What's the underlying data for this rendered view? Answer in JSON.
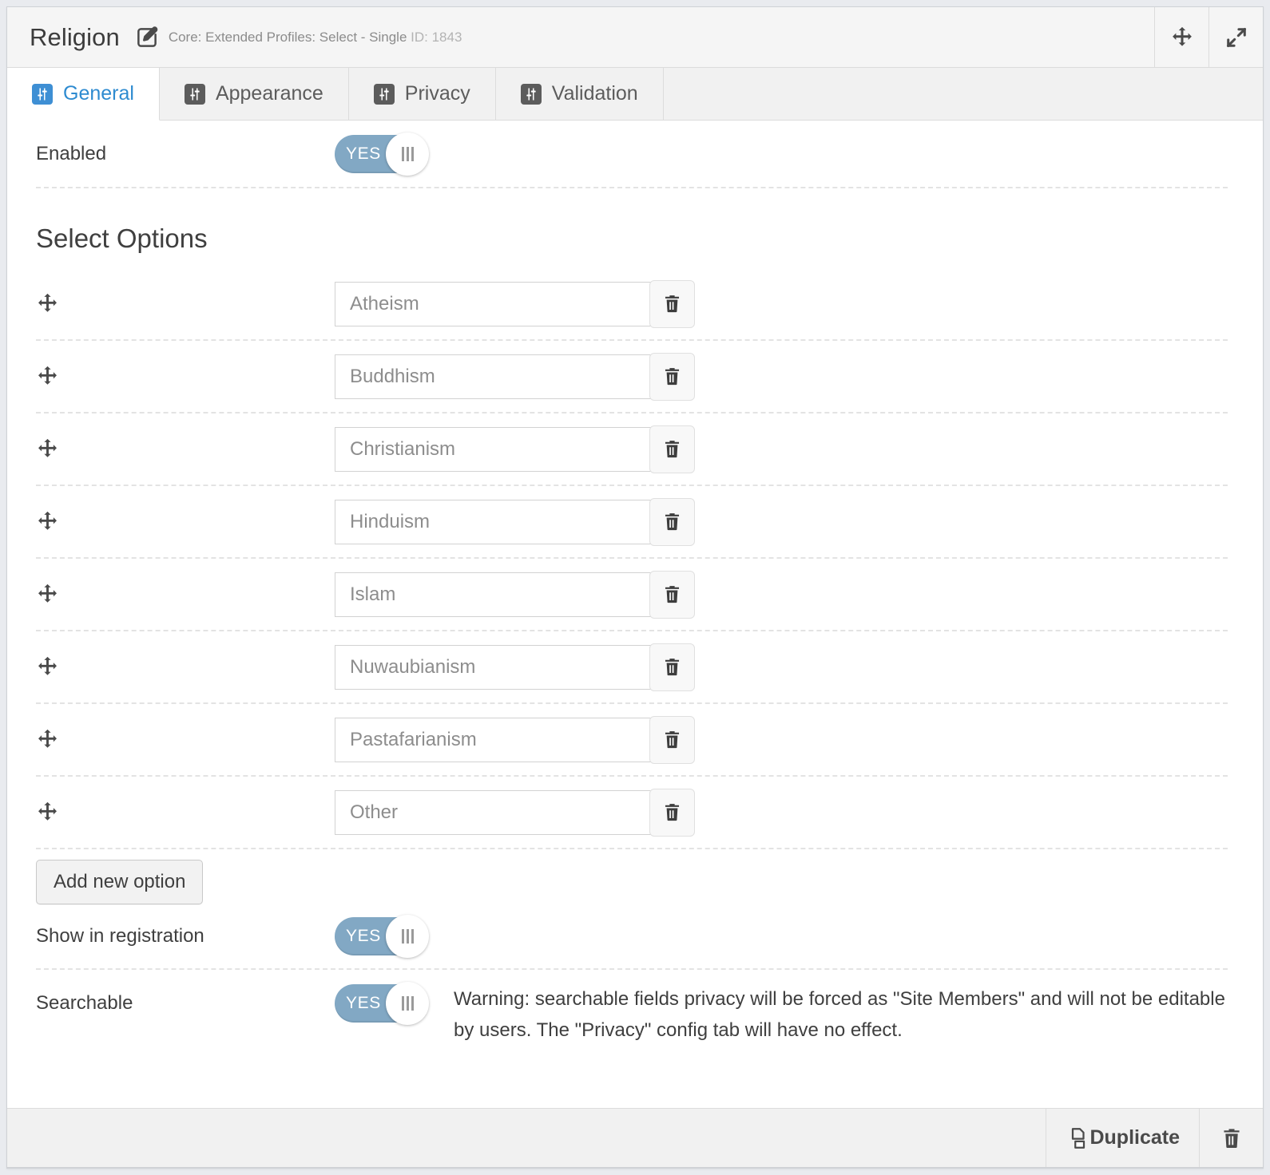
{
  "header": {
    "title": "Religion",
    "edit_icon": "edit-pencil-square-icon",
    "meta": "Core: Extended Profiles: Select - Single",
    "id_text": "ID: 1843",
    "move_icon": "move-arrows-icon",
    "collapse_icon": "collapse-arrows-icon"
  },
  "tabs": [
    {
      "label": "General",
      "icon": "sliders-icon",
      "active": true
    },
    {
      "label": "Appearance",
      "icon": "sliders-icon",
      "active": false
    },
    {
      "label": "Privacy",
      "icon": "sliders-icon",
      "active": false
    },
    {
      "label": "Validation",
      "icon": "sliders-icon",
      "active": false
    }
  ],
  "general": {
    "enabled_label": "Enabled",
    "enabled_toggle": "YES",
    "section_title": "Select Options",
    "options": [
      {
        "value": "Atheism",
        "placeholder": "Atheism"
      },
      {
        "value": "Buddhism",
        "placeholder": "Buddhism"
      },
      {
        "value": "Christianism",
        "placeholder": "Christianism"
      },
      {
        "value": "Hinduism",
        "placeholder": "Hinduism"
      },
      {
        "value": "Islam",
        "placeholder": "Islam"
      },
      {
        "value": "Nuwaubianism",
        "placeholder": "Nuwaubianism"
      },
      {
        "value": "Pastafarianism",
        "placeholder": "Pastafarianism"
      },
      {
        "value": "Other",
        "placeholder": "Other"
      }
    ],
    "delete_icon": "trash-icon",
    "drag_icon": "move-arrows-icon",
    "add_option_label": "Add new option",
    "show_in_registration_label": "Show in registration",
    "show_in_registration_toggle": "YES",
    "searchable_label": "Searchable",
    "searchable_toggle": "YES",
    "searchable_warning": "Warning: searchable fields privacy will be forced as \"Site Members\" and will not be editable by users. The \"Privacy\" config tab will have no effect."
  },
  "footer": {
    "duplicate_label": "Duplicate",
    "duplicate_icon": "copy-icon",
    "delete_icon": "trash-icon"
  },
  "colors": {
    "accent": "#3e8fd4",
    "toggle_on": "#82a8c4",
    "panel_bg": "#ffffff",
    "chrome_bg": "#f1f1f1",
    "page_bg": "#e9ebef"
  }
}
